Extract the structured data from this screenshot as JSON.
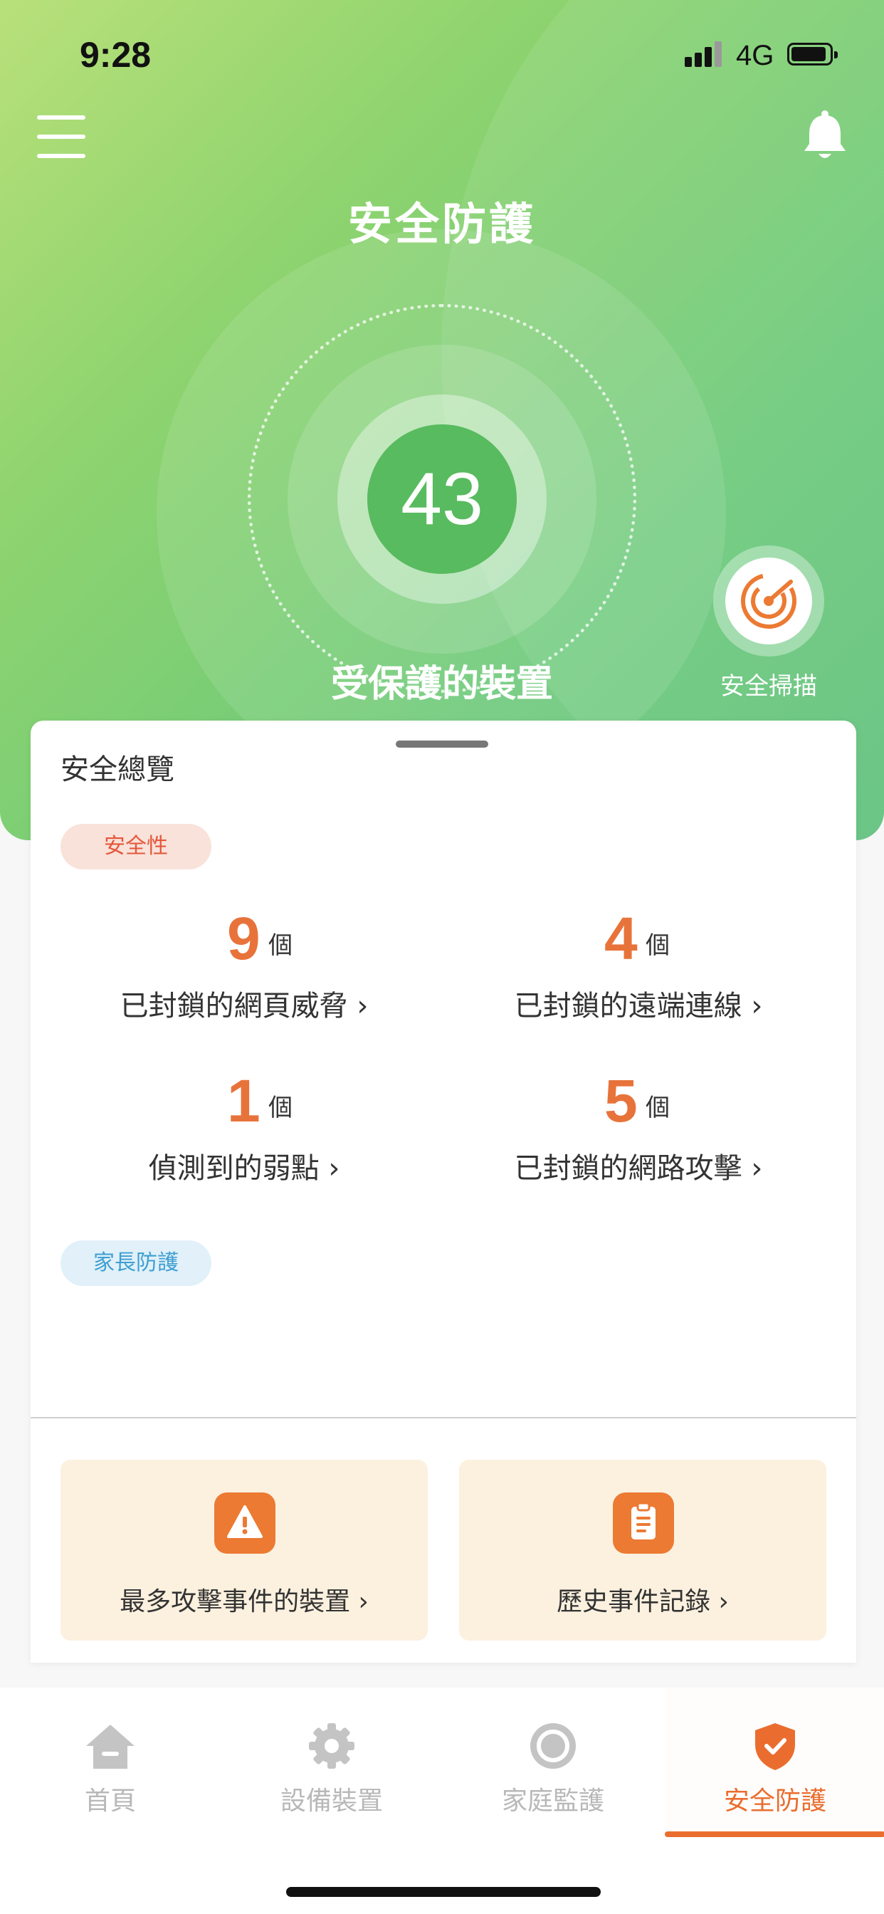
{
  "status_bar": {
    "time": "9:28",
    "network": "4G"
  },
  "header": {
    "title": "安全防護"
  },
  "hero": {
    "score": "43",
    "protected_label": "受保護的裝置",
    "scan_label": "安全掃描"
  },
  "overview": {
    "title": "安全總覽",
    "security_tag": "安全性",
    "parental_tag": "家長防護",
    "unit": "個",
    "stats": [
      {
        "value": "9",
        "label": "已封鎖的網頁威脅"
      },
      {
        "value": "4",
        "label": "已封鎖的遠端連線"
      },
      {
        "value": "1",
        "label": "偵測到的弱點"
      },
      {
        "value": "5",
        "label": "已封鎖的網路攻擊"
      }
    ],
    "actions": [
      {
        "label": "最多攻擊事件的裝置",
        "icon": "warning-icon"
      },
      {
        "label": "歷史事件記錄",
        "icon": "clipboard-icon"
      }
    ]
  },
  "tabbar": {
    "tabs": [
      {
        "label": "首頁",
        "icon": "home-icon"
      },
      {
        "label": "設備裝置",
        "icon": "gear-icon"
      },
      {
        "label": "家庭監護",
        "icon": "family-icon"
      },
      {
        "label": "安全防護",
        "icon": "shield-icon",
        "active": true
      }
    ],
    "active_color": "#ea6d2f"
  },
  "colors": {
    "accent": "#e8733a",
    "hero_green": "#58bb5f"
  }
}
